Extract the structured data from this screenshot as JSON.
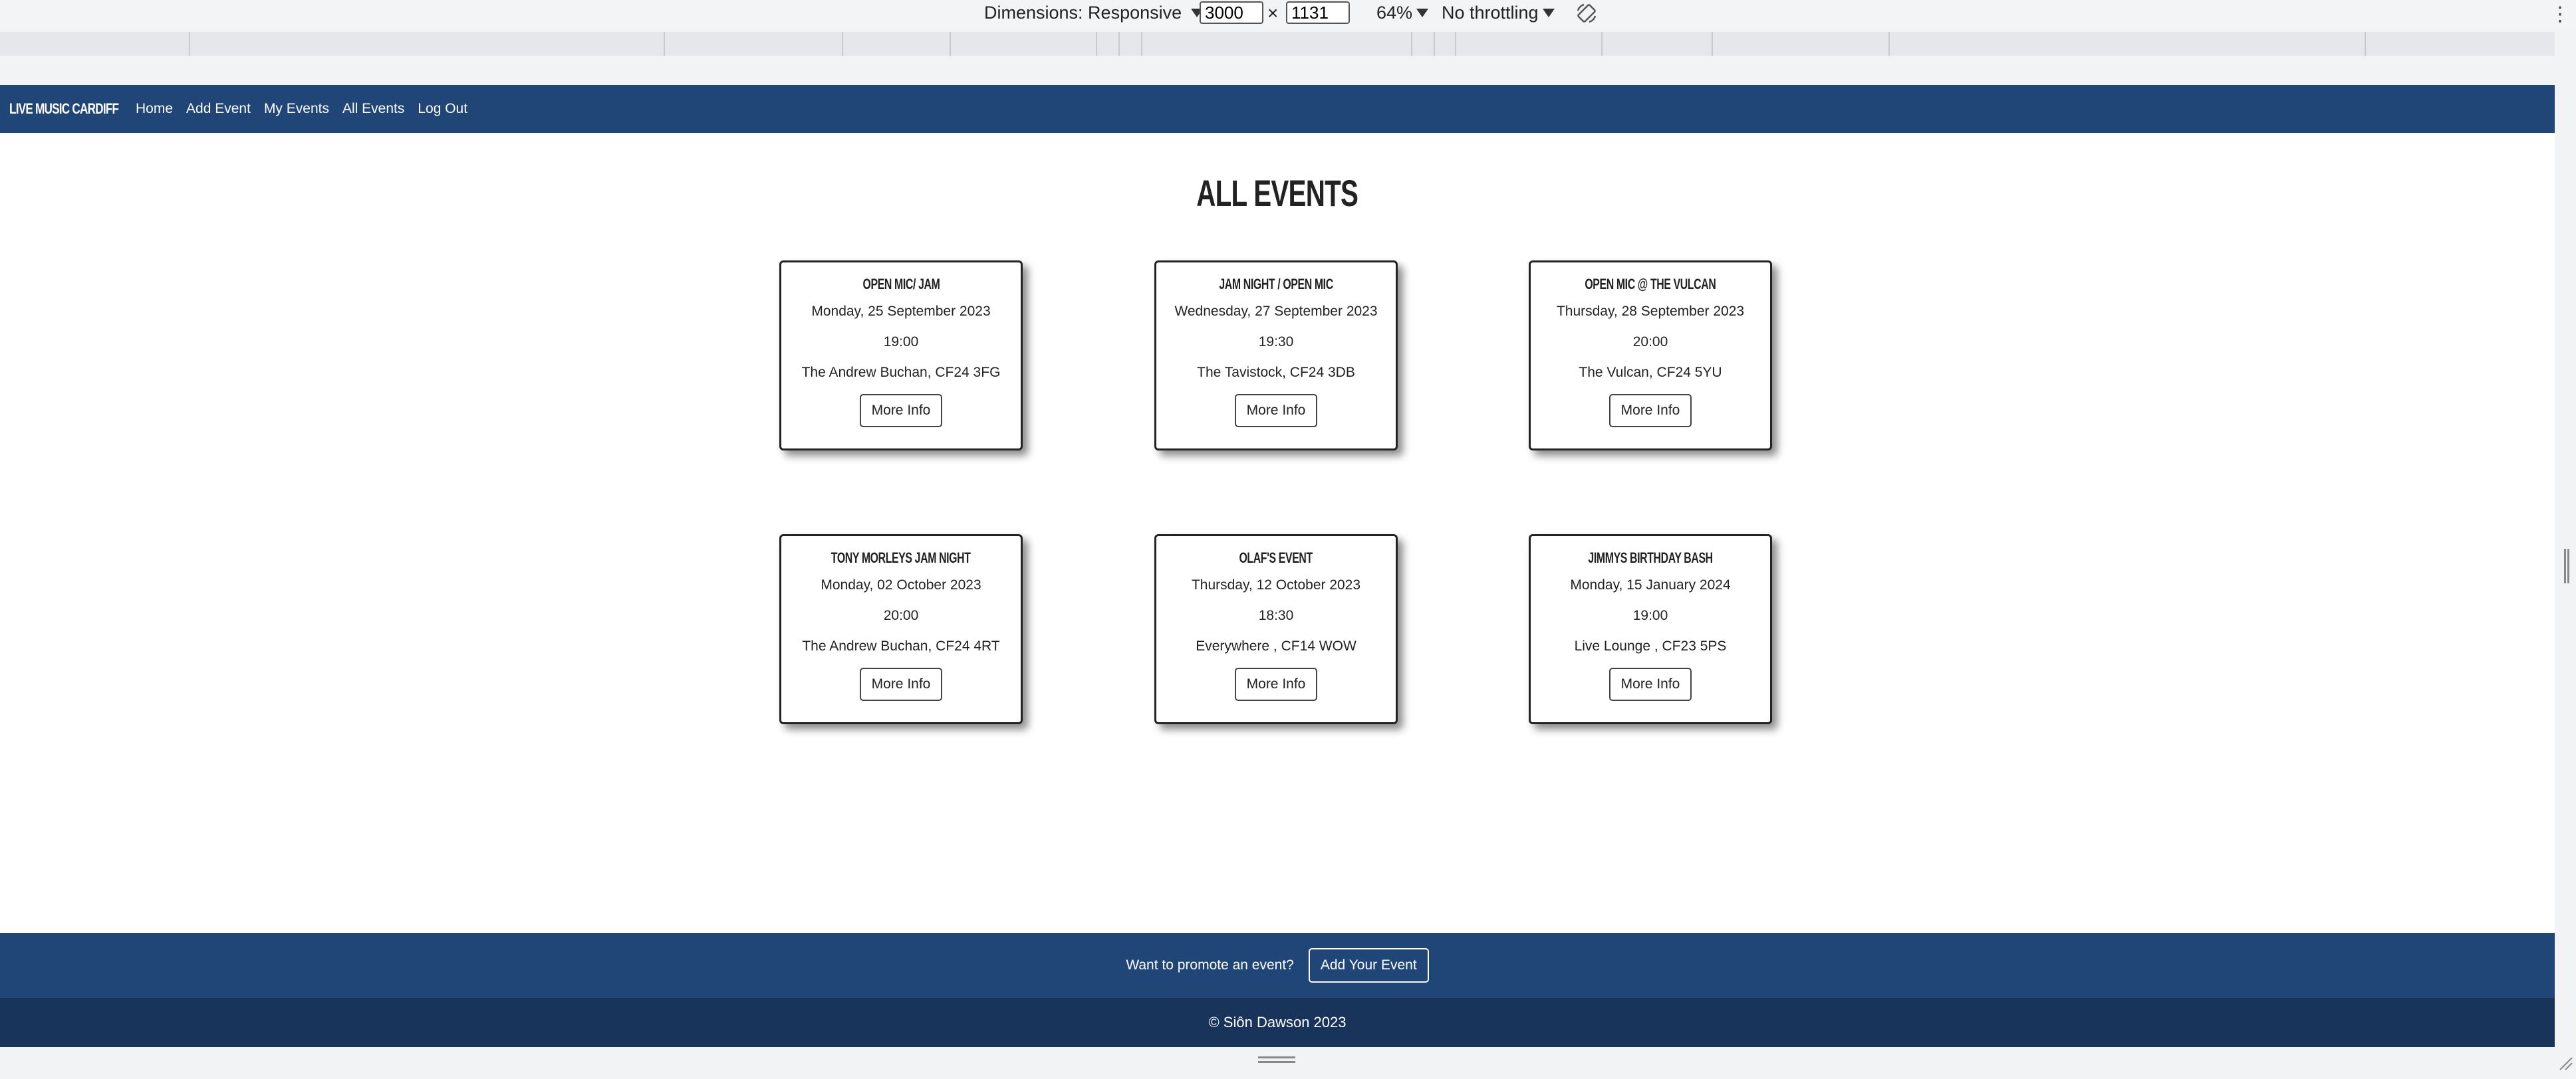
{
  "devtools": {
    "dimensions_label": "Dimensions: Responsive",
    "width_value": "3000",
    "height_value": "1131",
    "times_symbol": "×",
    "zoom_label": "64%",
    "throttle_label": "No throttling",
    "rotate_icon": "rotate-icon",
    "more_icon": "kebab-menu-icon"
  },
  "navbar": {
    "brand": "Live Music Cardiff",
    "links": [
      "Home",
      "Add Event",
      "My Events",
      "All Events",
      "Log Out"
    ],
    "color": "#1f4677"
  },
  "main": {
    "title": "All Events",
    "events": [
      {
        "title": "Open Mic/ Jam",
        "date": "Monday, 25 September 2023",
        "time": "19:00",
        "venue": "The Andrew Buchan, CF24 3FG",
        "button": "More Info"
      },
      {
        "title": "Jam Night / Open Mic",
        "date": "Wednesday, 27 September 2023",
        "time": "19:30",
        "venue": "The Tavistock, CF24 3DB",
        "button": "More Info"
      },
      {
        "title": "Open mic @ The Vulcan",
        "date": "Thursday, 28 September 2023",
        "time": "20:00",
        "venue": "The Vulcan, CF24 5YU",
        "button": "More Info"
      },
      {
        "title": "Tony Morleys Jam night",
        "date": "Monday, 02 October 2023",
        "time": "20:00",
        "venue": "The Andrew Buchan, CF24 4RT",
        "button": "More Info"
      },
      {
        "title": "Olaf's Event",
        "date": "Thursday, 12 October 2023",
        "time": "18:30",
        "venue": "Everywhere , CF14 WOW",
        "button": "More Info"
      },
      {
        "title": "Jimmys birthday bash",
        "date": "Monday, 15 January 2024",
        "time": "19:00",
        "venue": "Live Lounge , CF23 5PS",
        "button": "More Info"
      }
    ]
  },
  "footer": {
    "promo_text": "Want to promote an event?",
    "promo_button": "Add Your Event",
    "copyright": "© Siôn Dawson 2023",
    "top_color": "#1f4677",
    "bottom_color": "#18345a"
  }
}
